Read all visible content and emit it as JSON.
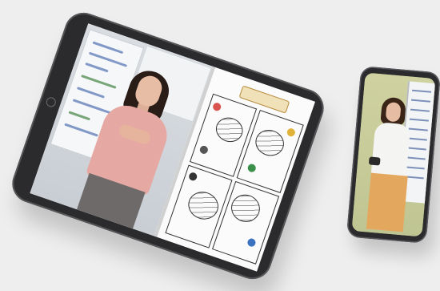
{
  "scene": {
    "background_color": "#eeeeee"
  },
  "tablet": {
    "frame_color": "#2b2b2d",
    "video": {
      "presenter_top_color": "#e5a8a2",
      "presenter_hair_color": "#2a1c16"
    },
    "flipchart": {
      "title_color": "#f0e1b8",
      "icon_names": [
        "home-button-icon"
      ]
    }
  },
  "phone": {
    "frame_color": "#2b2b2d",
    "video": {
      "presenter_top_color": "#f4f4f2",
      "presenter_skirt_color": "#e3a85e"
    }
  }
}
